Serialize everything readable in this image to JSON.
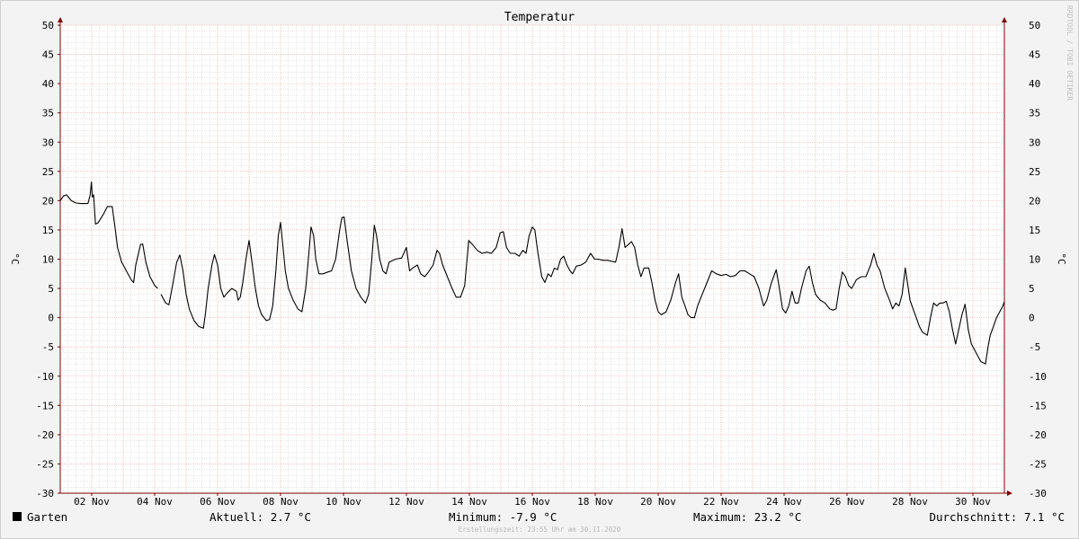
{
  "chart_data": {
    "type": "line",
    "title": "Temperatur",
    "ylabel": "°C",
    "ylim": [
      -30,
      50
    ],
    "yticks": [
      50,
      45,
      40,
      35,
      30,
      25,
      20,
      15,
      10,
      5,
      0,
      -5,
      -10,
      -15,
      -20,
      -25,
      -30
    ],
    "xlim": [
      0,
      30
    ],
    "x_unit": "days since 01 Nov 2020 00:00",
    "xticks": [
      {
        "x": 1,
        "label": "02 Nov"
      },
      {
        "x": 3,
        "label": "04 Nov"
      },
      {
        "x": 5,
        "label": "06 Nov"
      },
      {
        "x": 7,
        "label": "08 Nov"
      },
      {
        "x": 9,
        "label": "10 Nov"
      },
      {
        "x": 11,
        "label": "12 Nov"
      },
      {
        "x": 13,
        "label": "14 Nov"
      },
      {
        "x": 15,
        "label": "16 Nov"
      },
      {
        "x": 17,
        "label": "18 Nov"
      },
      {
        "x": 19,
        "label": "20 Nov"
      },
      {
        "x": 21,
        "label": "22 Nov"
      },
      {
        "x": 23,
        "label": "24 Nov"
      },
      {
        "x": 25,
        "label": "26 Nov"
      },
      {
        "x": 27,
        "label": "28 Nov"
      },
      {
        "x": 29,
        "label": "30 Nov"
      }
    ],
    "grid": true,
    "series": [
      {
        "name": "Garten",
        "color": "#000000",
        "segments": [
          [
            [
              0.0,
              20.0
            ],
            [
              0.1,
              20.8
            ],
            [
              0.2,
              21.0
            ],
            [
              0.35,
              20.0
            ],
            [
              0.5,
              19.6
            ],
            [
              0.65,
              19.5
            ],
            [
              0.88,
              19.5
            ],
            [
              0.95,
              21.0
            ],
            [
              0.99,
              23.2
            ],
            [
              1.02,
              20.6
            ],
            [
              1.06,
              21.0
            ],
            [
              1.12,
              16.0
            ],
            [
              1.2,
              16.2
            ],
            [
              1.35,
              17.5
            ],
            [
              1.5,
              19.0
            ],
            [
              1.65,
              19.0
            ],
            [
              1.75,
              15.0
            ],
            [
              1.82,
              12.0
            ],
            [
              1.95,
              9.5
            ],
            [
              2.1,
              8.0
            ],
            [
              2.25,
              6.5
            ],
            [
              2.33,
              6.0
            ],
            [
              2.4,
              9.0
            ],
            [
              2.55,
              12.5
            ],
            [
              2.62,
              12.6
            ],
            [
              2.72,
              9.5
            ],
            [
              2.85,
              7.0
            ],
            [
              3.0,
              5.5
            ],
            [
              3.1,
              5.0
            ]
          ],
          [
            [
              3.2,
              4.0
            ],
            [
              3.35,
              2.5
            ],
            [
              3.45,
              2.2
            ],
            [
              3.55,
              5.0
            ],
            [
              3.7,
              9.5
            ],
            [
              3.8,
              10.7
            ],
            [
              3.9,
              8.0
            ],
            [
              4.0,
              4.0
            ],
            [
              4.1,
              1.5
            ],
            [
              4.25,
              -0.5
            ],
            [
              4.4,
              -1.5
            ],
            [
              4.55,
              -1.8
            ],
            [
              4.62,
              1.0
            ],
            [
              4.7,
              5.0
            ],
            [
              4.82,
              9.0
            ],
            [
              4.9,
              10.8
            ],
            [
              5.0,
              9.0
            ],
            [
              5.1,
              5.0
            ],
            [
              5.2,
              3.5
            ],
            [
              5.3,
              4.2
            ],
            [
              5.45,
              5.0
            ],
            [
              5.6,
              4.5
            ],
            [
              5.65,
              3.0
            ],
            [
              5.72,
              3.5
            ],
            [
              5.8,
              6.0
            ],
            [
              5.9,
              10.0
            ],
            [
              6.0,
              13.2
            ],
            [
              6.08,
              10.0
            ],
            [
              6.2,
              5.0
            ],
            [
              6.3,
              2.0
            ],
            [
              6.4,
              0.5
            ],
            [
              6.55,
              -0.5
            ],
            [
              6.65,
              -0.3
            ],
            [
              6.75,
              2.0
            ],
            [
              6.85,
              8.0
            ],
            [
              6.93,
              14.0
            ],
            [
              7.0,
              16.3
            ],
            [
              7.08,
              12.0
            ],
            [
              7.15,
              8.0
            ],
            [
              7.25,
              5.0
            ],
            [
              7.4,
              3.0
            ],
            [
              7.55,
              1.5
            ],
            [
              7.68,
              1.0
            ],
            [
              7.8,
              5.0
            ],
            [
              7.9,
              11.0
            ],
            [
              7.97,
              15.5
            ],
            [
              8.05,
              14.0
            ],
            [
              8.12,
              10.0
            ],
            [
              8.22,
              7.5
            ],
            [
              8.35,
              7.5
            ],
            [
              8.5,
              7.8
            ],
            [
              8.62,
              8.0
            ],
            [
              8.75,
              10.0
            ],
            [
              8.88,
              15.0
            ],
            [
              8.95,
              17.1
            ],
            [
              9.02,
              17.2
            ],
            [
              9.12,
              13.0
            ],
            [
              9.25,
              8.0
            ],
            [
              9.4,
              5.0
            ],
            [
              9.55,
              3.5
            ],
            [
              9.7,
              2.5
            ],
            [
              9.8,
              4.0
            ],
            [
              9.9,
              10.0
            ],
            [
              9.98,
              15.8
            ],
            [
              10.05,
              14.0
            ],
            [
              10.15,
              10.0
            ],
            [
              10.25,
              8.0
            ],
            [
              10.35,
              7.5
            ],
            [
              10.45,
              9.5
            ],
            [
              10.65,
              10.0
            ],
            [
              10.85,
              10.2
            ],
            [
              11.0,
              12.0
            ],
            [
              11.1,
              8.0
            ],
            [
              11.2,
              8.5
            ],
            [
              11.35,
              9.0
            ],
            [
              11.45,
              7.5
            ],
            [
              11.58,
              7.0
            ],
            [
              11.7,
              7.8
            ],
            [
              11.85,
              9.0
            ],
            [
              11.97,
              11.5
            ],
            [
              12.05,
              11.0
            ],
            [
              12.15,
              9.0
            ],
            [
              12.3,
              7.0
            ],
            [
              12.45,
              5.0
            ],
            [
              12.58,
              3.5
            ],
            [
              12.72,
              3.5
            ],
            [
              12.85,
              5.5
            ],
            [
              12.98,
              13.2
            ],
            [
              13.1,
              12.5
            ],
            [
              13.25,
              11.5
            ],
            [
              13.4,
              11.0
            ],
            [
              13.55,
              11.2
            ],
            [
              13.7,
              11.0
            ],
            [
              13.85,
              12.0
            ],
            [
              13.98,
              14.5
            ],
            [
              14.08,
              14.7
            ],
            [
              14.18,
              12.0
            ],
            [
              14.3,
              11.0
            ],
            [
              14.45,
              11.0
            ],
            [
              14.58,
              10.5
            ],
            [
              14.7,
              11.5
            ],
            [
              14.8,
              11.0
            ],
            [
              14.9,
              14.0
            ],
            [
              15.0,
              15.5
            ],
            [
              15.08,
              15.0
            ],
            [
              15.18,
              11.0
            ],
            [
              15.3,
              7.0
            ],
            [
              15.4,
              6.0
            ],
            [
              15.5,
              7.5
            ],
            [
              15.6,
              7.0
            ],
            [
              15.7,
              8.5
            ],
            [
              15.8,
              8.2
            ],
            [
              15.9,
              10.0
            ],
            [
              16.0,
              10.5
            ],
            [
              16.1,
              9.0
            ],
            [
              16.2,
              8.0
            ],
            [
              16.28,
              7.5
            ],
            [
              16.4,
              8.8
            ],
            [
              16.55,
              9.0
            ],
            [
              16.7,
              9.5
            ],
            [
              16.85,
              11.0
            ],
            [
              16.98,
              10.0
            ],
            [
              17.1,
              10.0
            ],
            [
              17.25,
              9.8
            ],
            [
              17.4,
              9.8
            ],
            [
              17.55,
              9.6
            ],
            [
              17.65,
              9.5
            ],
            [
              17.75,
              12.0
            ],
            [
              17.85,
              15.2
            ],
            [
              17.95,
              12.0
            ],
            [
              18.05,
              12.5
            ],
            [
              18.15,
              13.0
            ],
            [
              18.25,
              12.0
            ],
            [
              18.35,
              9.0
            ],
            [
              18.45,
              7.0
            ],
            [
              18.55,
              8.5
            ],
            [
              18.7,
              8.5
            ],
            [
              18.8,
              6.0
            ],
            [
              18.9,
              3.0
            ],
            [
              19.0,
              1.0
            ],
            [
              19.1,
              0.5
            ],
            [
              19.25,
              1.0
            ],
            [
              19.4,
              3.0
            ],
            [
              19.55,
              6.0
            ],
            [
              19.65,
              7.5
            ],
            [
              19.75,
              3.5
            ],
            [
              19.85,
              2.0
            ],
            [
              19.95,
              0.5
            ],
            [
              20.05,
              0.0
            ],
            [
              20.15,
              0.0
            ],
            [
              20.25,
              2.0
            ],
            [
              20.4,
              4.0
            ],
            [
              20.55,
              6.0
            ],
            [
              20.7,
              8.0
            ],
            [
              20.85,
              7.5
            ],
            [
              21.0,
              7.2
            ],
            [
              21.15,
              7.4
            ],
            [
              21.3,
              7.0
            ],
            [
              21.45,
              7.2
            ],
            [
              21.6,
              8.0
            ],
            [
              21.75,
              8.0
            ],
            [
              21.9,
              7.5
            ],
            [
              22.05,
              7.0
            ],
            [
              22.2,
              5.0
            ],
            [
              22.35,
              2.0
            ],
            [
              22.45,
              3.0
            ],
            [
              22.6,
              6.0
            ],
            [
              22.75,
              8.2
            ],
            [
              22.85,
              5.0
            ],
            [
              22.95,
              1.5
            ],
            [
              23.05,
              0.8
            ],
            [
              23.15,
              2.0
            ],
            [
              23.25,
              4.5
            ],
            [
              23.35,
              2.5
            ],
            [
              23.45,
              2.5
            ],
            [
              23.55,
              5.0
            ],
            [
              23.7,
              8.0
            ],
            [
              23.8,
              8.8
            ],
            [
              23.9,
              6.0
            ],
            [
              24.0,
              4.0
            ],
            [
              24.15,
              3.0
            ],
            [
              24.3,
              2.5
            ],
            [
              24.45,
              1.5
            ],
            [
              24.55,
              1.3
            ],
            [
              24.65,
              1.5
            ],
            [
              24.75,
              5.0
            ],
            [
              24.85,
              7.8
            ],
            [
              24.95,
              7.0
            ],
            [
              25.05,
              5.5
            ],
            [
              25.15,
              5.0
            ],
            [
              25.3,
              6.5
            ],
            [
              25.45,
              7.0
            ],
            [
              25.6,
              7.0
            ],
            [
              25.75,
              9.0
            ],
            [
              25.85,
              11.0
            ],
            [
              25.95,
              9.0
            ],
            [
              26.05,
              8.0
            ],
            [
              26.2,
              5.0
            ],
            [
              26.35,
              3.0
            ],
            [
              26.45,
              1.5
            ],
            [
              26.55,
              2.5
            ],
            [
              26.65,
              2.0
            ],
            [
              26.75,
              4.0
            ],
            [
              26.85,
              8.5
            ],
            [
              26.92,
              6.0
            ],
            [
              27.0,
              3.0
            ],
            [
              27.1,
              1.5
            ],
            [
              27.2,
              0.0
            ],
            [
              27.3,
              -1.5
            ],
            [
              27.4,
              -2.5
            ],
            [
              27.55,
              -3.0
            ],
            [
              27.65,
              0.0
            ],
            [
              27.75,
              2.5
            ],
            [
              27.85,
              2.0
            ],
            [
              27.95,
              2.5
            ],
            [
              28.05,
              2.5
            ],
            [
              28.15,
              2.8
            ],
            [
              28.25,
              1.0
            ],
            [
              28.35,
              -2.0
            ],
            [
              28.45,
              -4.5
            ],
            [
              28.55,
              -2.0
            ],
            [
              28.65,
              0.5
            ],
            [
              28.75,
              2.3
            ],
            [
              28.85,
              -2.0
            ],
            [
              28.95,
              -4.5
            ],
            [
              29.05,
              -5.5
            ],
            [
              29.15,
              -6.5
            ],
            [
              29.25,
              -7.5
            ],
            [
              29.4,
              -7.9
            ],
            [
              29.48,
              -5.0
            ],
            [
              29.55,
              -3.0
            ],
            [
              29.65,
              -1.5
            ],
            [
              29.75,
              0.0
            ],
            [
              29.85,
              1.0
            ],
            [
              29.95,
              2.0
            ],
            [
              30.0,
              2.7
            ]
          ]
        ]
      }
    ]
  },
  "legend": {
    "series_name": "Garten",
    "current": "Aktuell: 2.7 °C",
    "minimum": "Minimum: -7.9 °C",
    "maximum": "Maximum: 23.2 °C",
    "average": "Durchschnitt: 7.1 °C"
  },
  "footer": {
    "created": "Erstellungszeit: 23:55 Uhr am 30.11.2020"
  },
  "watermark": "RRDTOOL / TOBI OETIKER",
  "colors": {
    "background": "#f3f3f3",
    "plot_background": "#ffffff",
    "line": "#000000",
    "major_grid": "#e8a0a0",
    "minor_grid": "#d0d0d0",
    "axis": "#800000"
  }
}
